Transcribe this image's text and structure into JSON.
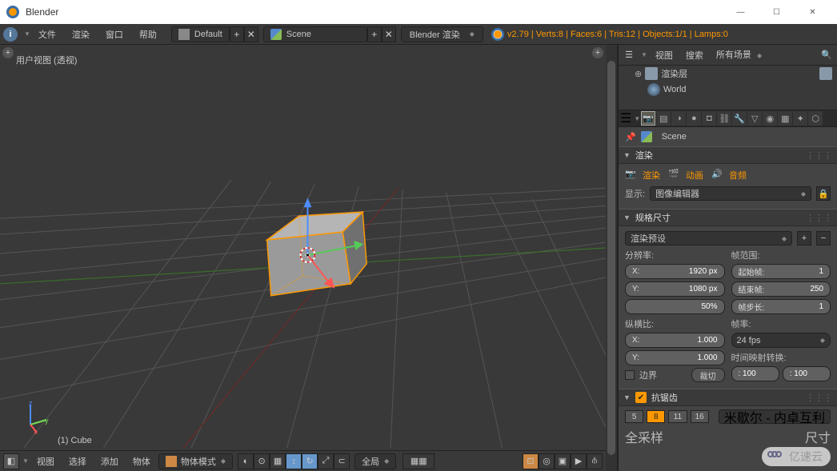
{
  "app": {
    "title": "Blender"
  },
  "window_buttons": {
    "min": "—",
    "max": "☐",
    "close": "✕"
  },
  "menubar": {
    "items": [
      "文件",
      "渲染",
      "窗口",
      "帮助"
    ],
    "info_icon": "i",
    "layout": "Default",
    "add": "+",
    "del": "✕",
    "scene": "Scene",
    "engine": "Blender 渲染",
    "version_line": "v2.79 | Verts:8 | Faces:6 | Tris:12 | Objects:1/1 | Lamps:0"
  },
  "viewport": {
    "label": "用户视图 (透视)",
    "object_name": "(1) Cube",
    "axes": {
      "x": "x",
      "y": "y",
      "z": "z"
    },
    "plus": "+"
  },
  "vp_toolbar": {
    "items": [
      "视图",
      "选择",
      "添加",
      "物体"
    ],
    "mode": "物体模式",
    "global": "全局"
  },
  "outliner": {
    "hdr": {
      "view": "视图",
      "search": "搜索",
      "all_scenes": "所有场景"
    },
    "rows": [
      {
        "label": "渲染层"
      },
      {
        "label": "World"
      }
    ]
  },
  "props": {
    "breadcrumb": "Scene",
    "sections": {
      "render": "渲染",
      "dimensions": "规格尺寸",
      "antialias": "抗锯齿",
      "sampling": "全采样",
      "sizes": "尺寸"
    },
    "render_btns": {
      "render": "渲染",
      "anim": "动画",
      "audio": "音频"
    },
    "display": {
      "label": "显示:",
      "value": "图像编辑器"
    },
    "preset": "渲染预设",
    "resolution": {
      "label": "分辨率:",
      "x_label": "X:",
      "x_value": "1920 px",
      "y_label": "Y:",
      "y_value": "1080 px",
      "pct": "50%"
    },
    "frames": {
      "label": "帧范围:",
      "start_label": "起始帧:",
      "start_value": "1",
      "end_label": "结束帧:",
      "end_value": "250",
      "step_label": "帧步长:",
      "step_value": "1"
    },
    "aspect": {
      "label": "纵横比:",
      "x_label": "X:",
      "x_value": "1.000",
      "y_label": "Y:",
      "y_value": "1.000"
    },
    "framerate": {
      "label": "帧率:",
      "value": "24 fps"
    },
    "remap": {
      "label": "时间映射转换:",
      "a": ": 100",
      "b": ": 100"
    },
    "border": {
      "label": "边界",
      "crop": "裁切"
    },
    "aa_samples": [
      "5",
      "8",
      "11",
      "16"
    ],
    "aa_samples_active": "8",
    "aa_filter": "米歇尔 - 内卓互利"
  },
  "watermark": "亿速云"
}
